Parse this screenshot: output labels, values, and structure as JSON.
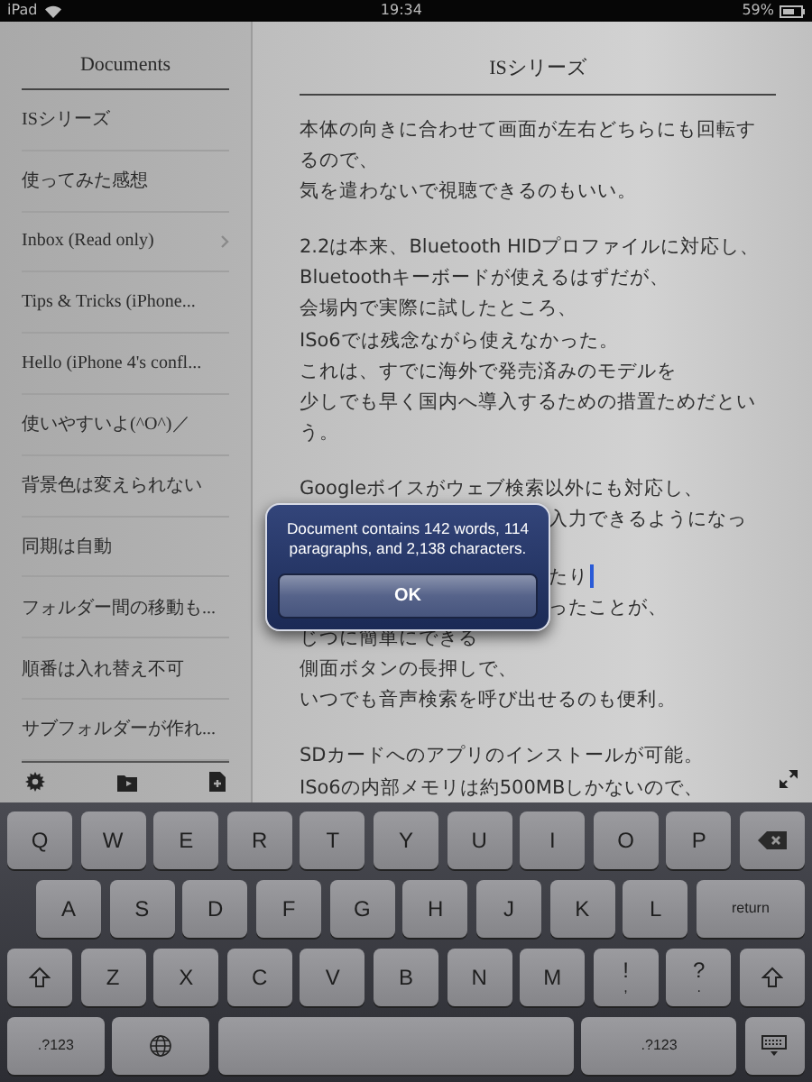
{
  "status_bar": {
    "device": "iPad",
    "time": "19:34",
    "battery": "59%"
  },
  "sidebar": {
    "title": "Documents",
    "items": [
      {
        "label": "ISシリーズ",
        "chevron": false
      },
      {
        "label": "使ってみた感想",
        "chevron": false
      },
      {
        "label": "Inbox (Read only)",
        "chevron": true
      },
      {
        "label": "Tips & Tricks (iPhone...",
        "chevron": false
      },
      {
        "label": "Hello (iPhone 4's confl...",
        "chevron": false
      },
      {
        "label": "使いやすいよ(^O^)／",
        "chevron": false
      },
      {
        "label": "背景色は変えられない",
        "chevron": false
      },
      {
        "label": "同期は自動",
        "chevron": false
      },
      {
        "label": "フォルダー間の移動も...",
        "chevron": false
      },
      {
        "label": "順番は入れ替え不可",
        "chevron": false
      },
      {
        "label": "サブフォルダーが作れ...",
        "chevron": false
      }
    ]
  },
  "document": {
    "title": "ISシリーズ",
    "lines": [
      {
        "kind": "full",
        "text": "本体の向きに合わせて画面が左右どちらにも回転す"
      },
      {
        "kind": "full",
        "text": "るので、"
      },
      {
        "kind": "full",
        "text": "気を遣わないで視聴できるのもいい。"
      },
      {
        "kind": "blank"
      },
      {
        "kind": "full",
        "text": "2.2は本来、Bluetooth HIDプロファイルに対応し、"
      },
      {
        "kind": "full",
        "text": "Bluetoothキーボードが使えるはずだが、"
      },
      {
        "kind": "full",
        "text": "会場内で実際に試したところ、"
      },
      {
        "kind": "full",
        "text": "ISo6では残念ながら使えなかった。"
      },
      {
        "kind": "full",
        "text": "これは、すでに海外で発売済みのモデルを"
      },
      {
        "kind": "full",
        "text": "少しでも早く国内へ導入するための措置ためだとい"
      },
      {
        "kind": "full",
        "text": "う。"
      },
      {
        "kind": "blank"
      },
      {
        "kind": "full",
        "text": "Googleボイスがウェブ検索以外にも対応し、"
      },
      {
        "kind": "partial",
        "text": "入力できるようになっ"
      },
      {
        "kind": "blank"
      },
      {
        "kind": "partial",
        "text": "たり",
        "cursor": true
      },
      {
        "kind": "partial",
        "text": "ったことが、"
      },
      {
        "kind": "full",
        "text": "じつに簡単にできる"
      },
      {
        "kind": "full",
        "text": "側面ボタンの長押しで、"
      },
      {
        "kind": "full",
        "text": "いつでも音声検索を呼び出せるのも便利。"
      },
      {
        "kind": "blank"
      },
      {
        "kind": "full",
        "text": "SDカードへのアプリのインストールが可能。"
      },
      {
        "kind": "full",
        "text": "ISo6の内部メモリは約500MBしかないので、"
      }
    ]
  },
  "alert": {
    "message": "Document contains 142 words, 114 paragraphs, and 2,138 characters.",
    "button": "OK"
  },
  "keyboard": {
    "rows": [
      [
        {
          "kind": "char",
          "label": "Q"
        },
        {
          "kind": "char",
          "label": "W"
        },
        {
          "kind": "char",
          "label": "E"
        },
        {
          "kind": "char",
          "label": "R"
        },
        {
          "kind": "char",
          "label": "T"
        },
        {
          "kind": "char",
          "label": "Y"
        },
        {
          "kind": "char",
          "label": "U"
        },
        {
          "kind": "char",
          "label": "I"
        },
        {
          "kind": "char",
          "label": "O"
        },
        {
          "kind": "char",
          "label": "P"
        },
        {
          "kind": "delete"
        }
      ],
      [
        {
          "kind": "char",
          "label": "A"
        },
        {
          "kind": "char",
          "label": "S"
        },
        {
          "kind": "char",
          "label": "D"
        },
        {
          "kind": "char",
          "label": "F"
        },
        {
          "kind": "char",
          "label": "G"
        },
        {
          "kind": "char",
          "label": "H"
        },
        {
          "kind": "char",
          "label": "J"
        },
        {
          "kind": "char",
          "label": "K"
        },
        {
          "kind": "char",
          "label": "L"
        },
        {
          "kind": "return",
          "label": "return"
        }
      ],
      [
        {
          "kind": "shift"
        },
        {
          "kind": "char",
          "label": "Z"
        },
        {
          "kind": "char",
          "label": "X"
        },
        {
          "kind": "char",
          "label": "C"
        },
        {
          "kind": "char",
          "label": "V"
        },
        {
          "kind": "char",
          "label": "B"
        },
        {
          "kind": "char",
          "label": "N"
        },
        {
          "kind": "char",
          "label": "M"
        },
        {
          "kind": "dual",
          "label": "!",
          "sub": ","
        },
        {
          "kind": "dual",
          "label": "?",
          "sub": "."
        },
        {
          "kind": "shift"
        }
      ],
      [
        {
          "kind": "mode",
          "label": ".?123"
        },
        {
          "kind": "globe"
        },
        {
          "kind": "space"
        },
        {
          "kind": "mode-wide",
          "label": ".?123"
        },
        {
          "kind": "hide"
        }
      ]
    ]
  }
}
